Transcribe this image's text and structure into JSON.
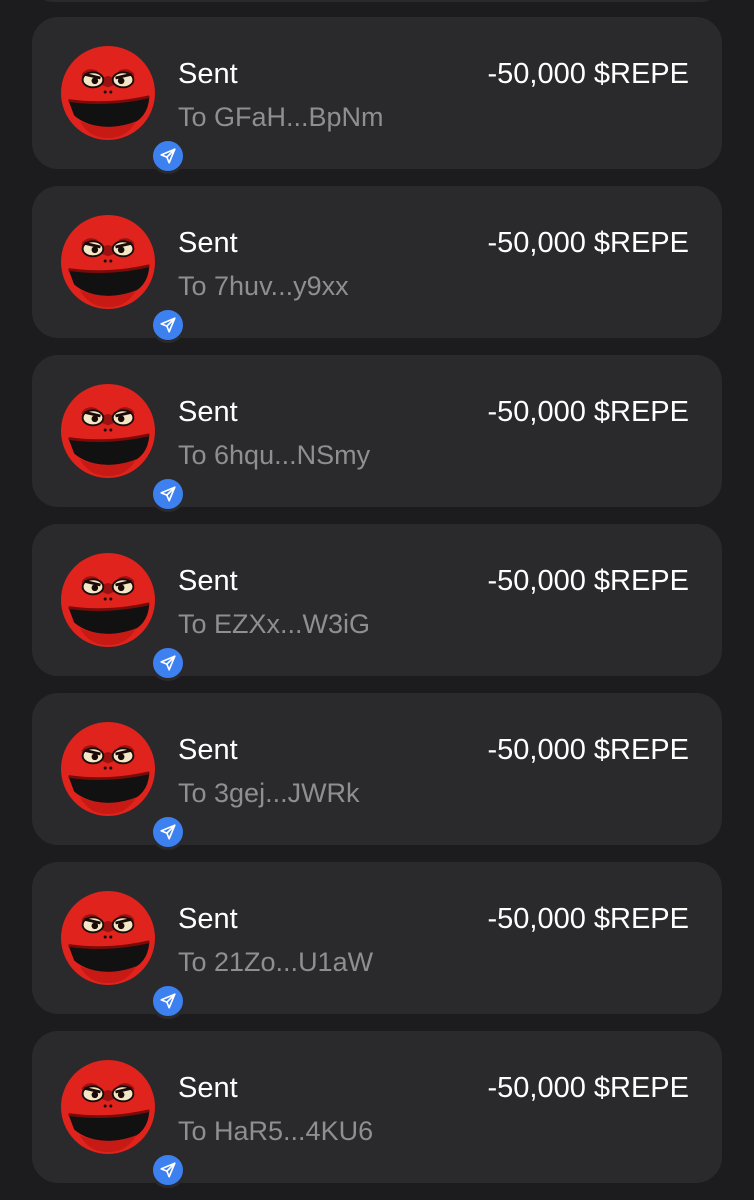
{
  "transactions": [
    {
      "title": "Sent",
      "subtitle": "To GFaH...BpNm",
      "amount": "-50,000 $REPE",
      "icon": "send-arrow-icon"
    },
    {
      "title": "Sent",
      "subtitle": "To 7huv...y9xx",
      "amount": "-50,000 $REPE",
      "icon": "send-arrow-icon"
    },
    {
      "title": "Sent",
      "subtitle": "To 6hqu...NSmy",
      "amount": "-50,000 $REPE",
      "icon": "send-arrow-icon"
    },
    {
      "title": "Sent",
      "subtitle": "To EZXx...W3iG",
      "amount": "-50,000 $REPE",
      "icon": "send-arrow-icon"
    },
    {
      "title": "Sent",
      "subtitle": "To 3gej...JWRk",
      "amount": "-50,000 $REPE",
      "icon": "send-arrow-icon"
    },
    {
      "title": "Sent",
      "subtitle": "To 21Zo...U1aW",
      "amount": "-50,000 $REPE",
      "icon": "send-arrow-icon"
    },
    {
      "title": "Sent",
      "subtitle": "To HaR5...4KU6",
      "amount": "-50,000 $REPE",
      "icon": "send-arrow-icon"
    }
  ],
  "colors": {
    "background": "#1c1c1e",
    "card": "#2a2a2c",
    "badge": "#3d80f0",
    "token_red": "#e0231c",
    "subtitle": "#8e8e93"
  }
}
